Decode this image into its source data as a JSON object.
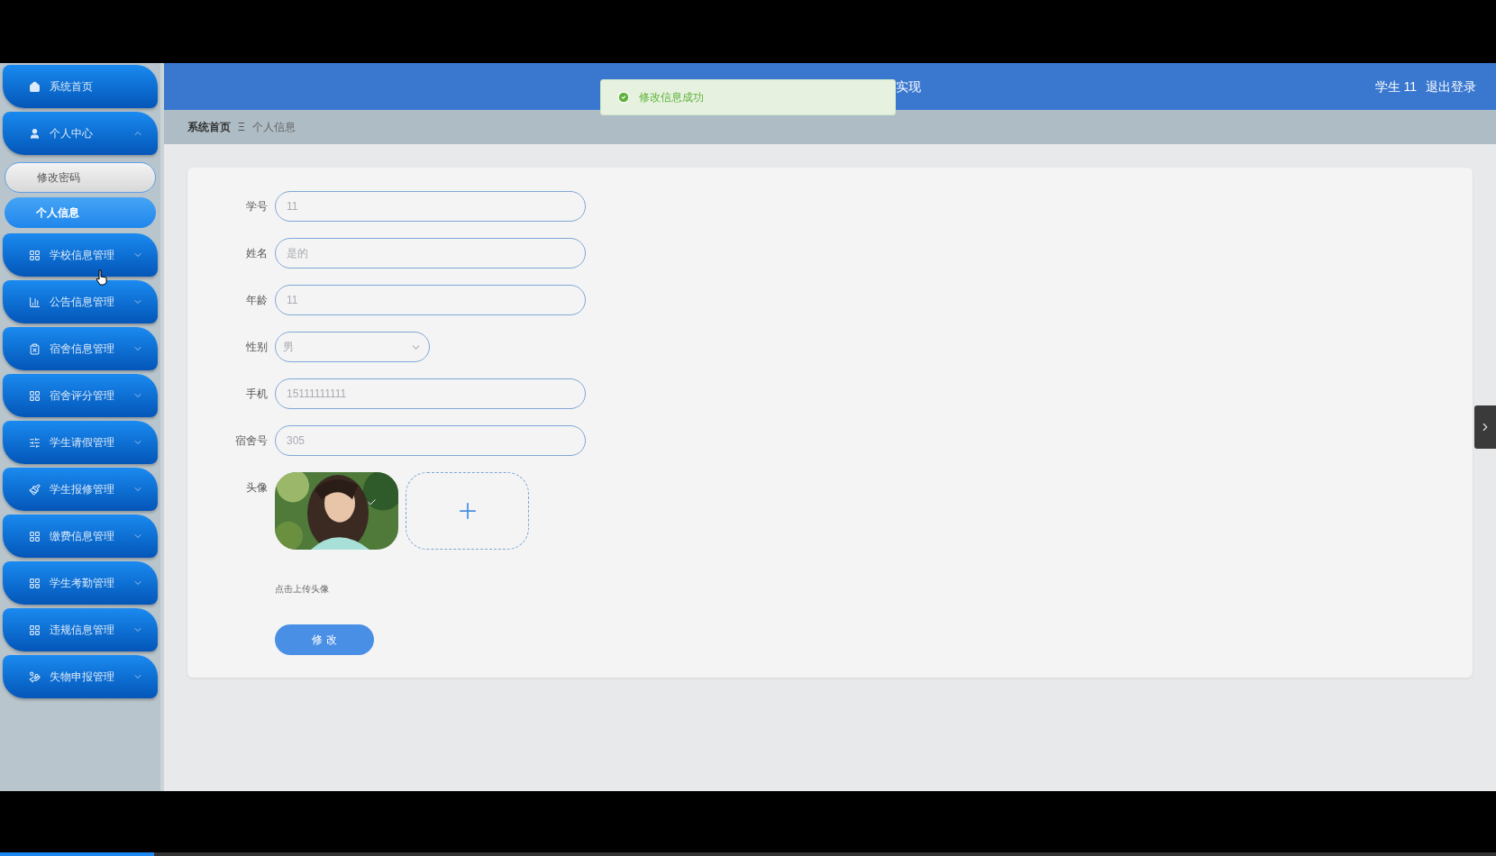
{
  "sidebar": {
    "items": [
      {
        "label": "系统首页",
        "has_children": false
      },
      {
        "label": "个人中心",
        "expanded": true,
        "has_children": true,
        "children": [
          {
            "label": "修改密码",
            "selected": false
          },
          {
            "label": "个人信息",
            "selected": true
          }
        ]
      },
      {
        "label": "学校信息管理",
        "expanded": false,
        "has_children": true
      },
      {
        "label": "公告信息管理",
        "expanded": false,
        "has_children": true
      },
      {
        "label": "宿舍信息管理",
        "expanded": false,
        "has_children": true
      },
      {
        "label": "宿舍评分管理",
        "expanded": false,
        "has_children": true
      },
      {
        "label": "学生请假管理",
        "expanded": false,
        "has_children": true
      },
      {
        "label": "学生报修管理",
        "expanded": false,
        "has_children": true
      },
      {
        "label": "缴费信息管理",
        "expanded": false,
        "has_children": true
      },
      {
        "label": "学生考勤管理",
        "expanded": false,
        "has_children": true
      },
      {
        "label": "违规信息管理",
        "expanded": false,
        "has_children": true
      },
      {
        "label": "失物申报管理",
        "expanded": false,
        "has_children": true
      }
    ]
  },
  "header": {
    "title": "实现",
    "user": "学生 11",
    "logout": "退出登录"
  },
  "toast": {
    "message": "修改信息成功"
  },
  "breadcrumb": {
    "items": [
      "系统首页",
      "个人信息"
    ],
    "separator": "Ξ"
  },
  "form": {
    "fields": [
      {
        "kind": "text",
        "label": "学号",
        "value": "11"
      },
      {
        "kind": "text",
        "label": "姓名",
        "value": "是的"
      },
      {
        "kind": "text",
        "label": "年龄",
        "value": "11"
      },
      {
        "kind": "select",
        "label": "性别",
        "value": "男"
      },
      {
        "kind": "text",
        "label": "手机",
        "value": "15111111111"
      },
      {
        "kind": "text",
        "label": "宿舍号",
        "value": "305"
      },
      {
        "kind": "upload",
        "label": "头像",
        "hint": "点击上传头像"
      }
    ],
    "submit": "修 改"
  },
  "player": {
    "level": 0.103
  }
}
